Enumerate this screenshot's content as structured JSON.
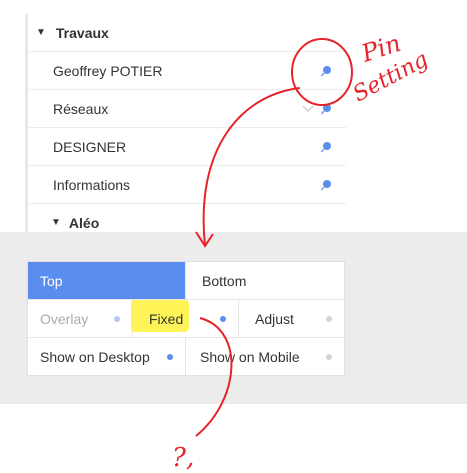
{
  "list": {
    "group_title": "Travaux",
    "items": [
      {
        "label": "Geoffrey POTIER",
        "has_chevron": false
      },
      {
        "label": "Réseaux",
        "has_chevron": true
      },
      {
        "label": "DESIGNER",
        "has_chevron": false
      },
      {
        "label": "Informations",
        "has_chevron": false
      }
    ],
    "subgroup_title": "Aléo"
  },
  "position_row": {
    "top": "Top",
    "bottom": "Bottom",
    "selected": "Top"
  },
  "mode_row": {
    "overlay": "Overlay",
    "fixed": "Fixed",
    "adjust": "Adjust",
    "selected": "Fixed"
  },
  "device_row": {
    "desktop": "Show on Desktop",
    "mobile": "Show on Mobile"
  },
  "annotations": {
    "note": "Pin Setting",
    "question": "?,"
  },
  "colors": {
    "accent": "#5b8def",
    "annotation": "#e8222a",
    "highlight": "#fff23a"
  },
  "icons": [
    "triangle-down-icon",
    "pin-icon",
    "chevron-down-icon"
  ]
}
